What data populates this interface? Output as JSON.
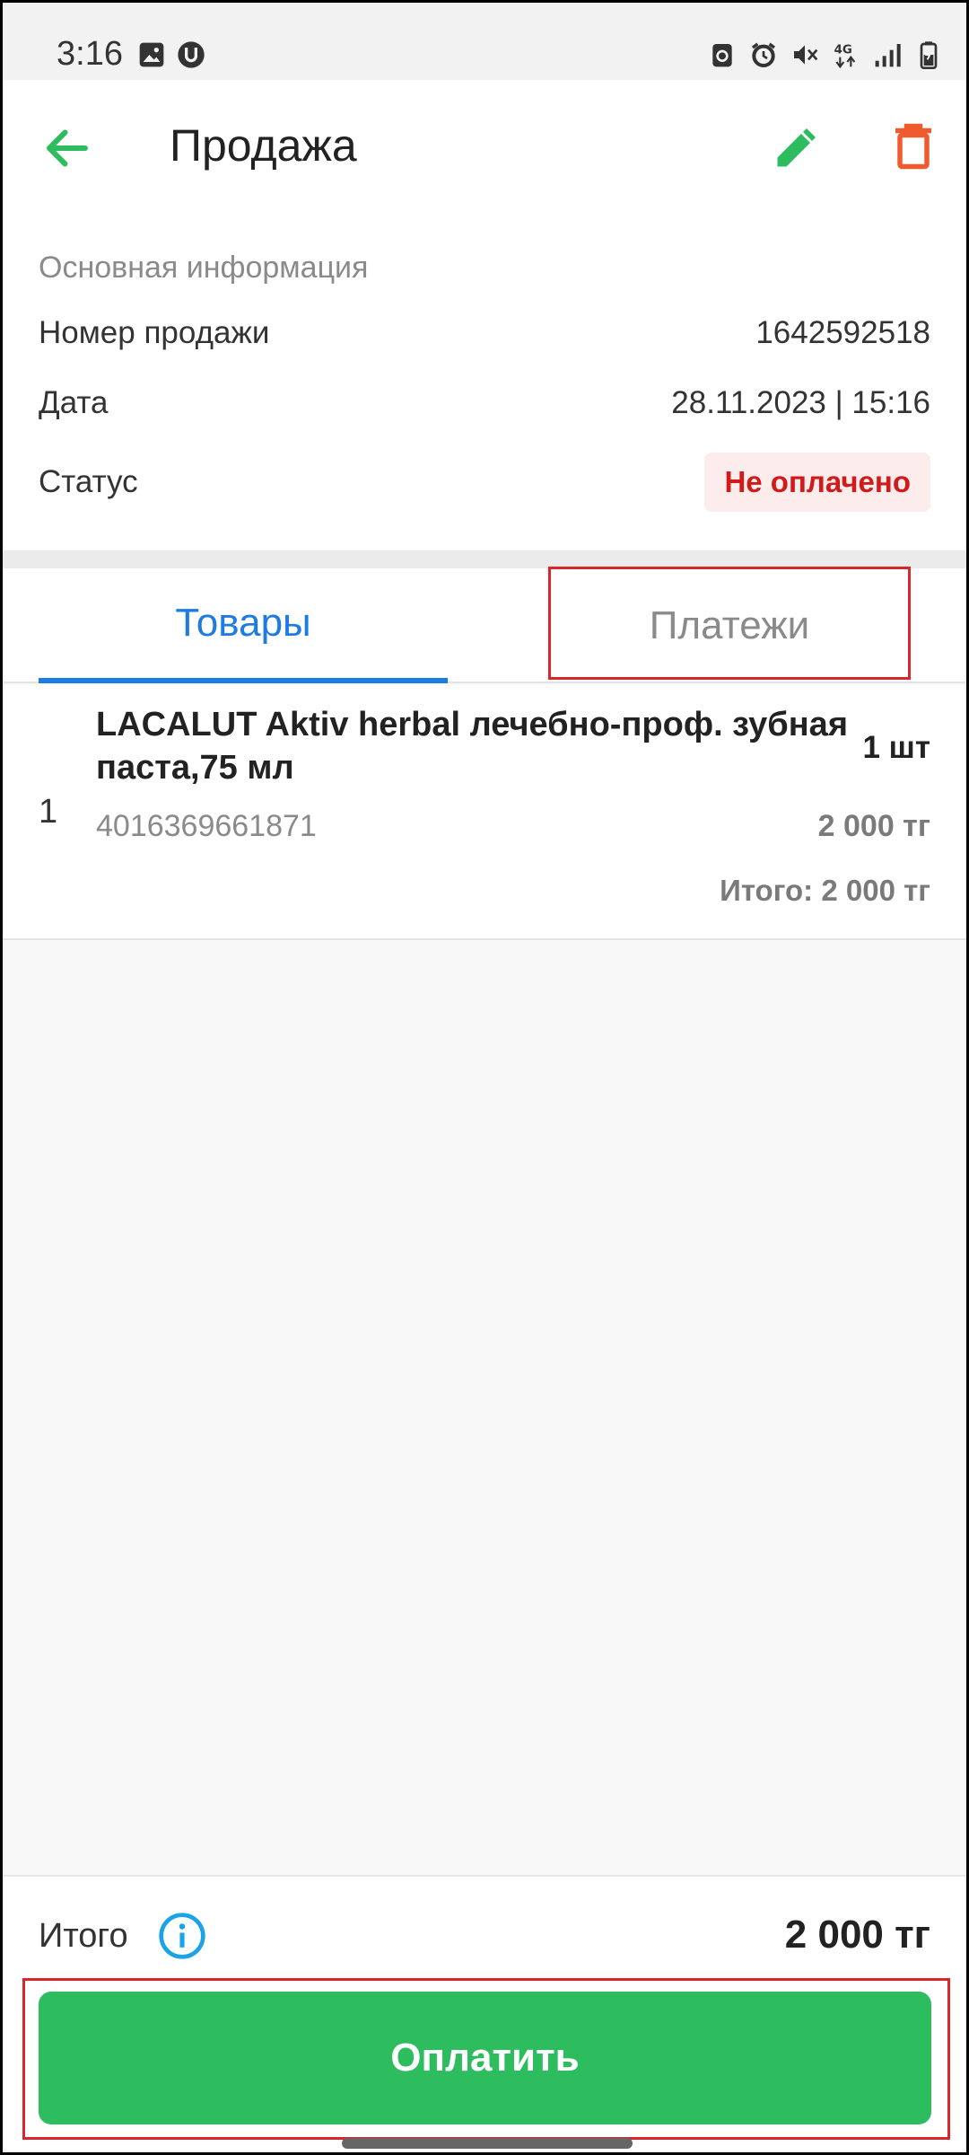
{
  "status_bar": {
    "time": "3:16",
    "left_icons": [
      "image-icon",
      "u-app-icon"
    ],
    "right_icons": [
      "recycle-icon",
      "alarm-icon",
      "mute-icon",
      "4g-icon",
      "signal-icon",
      "battery-icon"
    ]
  },
  "appbar": {
    "title": "Продажа",
    "back_icon": "arrow-left-icon",
    "edit_icon": "pencil-icon",
    "delete_icon": "trash-icon"
  },
  "info": {
    "heading": "Основная информация",
    "number_label": "Номер продажи",
    "number_value": "1642592518",
    "date_label": "Дата",
    "date_value": "28.11.2023 | 15:16",
    "status_label": "Статус",
    "status_value": "Не оплачено"
  },
  "tabs": [
    {
      "label": "Товары",
      "active": true
    },
    {
      "label": "Платежи",
      "active": false
    }
  ],
  "items": [
    {
      "index": "1",
      "name": "LACALUT Aktiv herbal лечебно-проф. зубная паста,75 мл",
      "quantity": "1 шт",
      "barcode": "4016369661871",
      "price": "2 000 тг",
      "total": "Итого: 2 000 тг"
    }
  ],
  "footer": {
    "total_label": "Итого",
    "total_value": "2 000 тг",
    "pay_button": "Оплатить"
  },
  "colors": {
    "accent_green": "#2dbd5f",
    "accent_blue": "#1e7be0",
    "danger_red": "#d11a1a",
    "highlight_red": "#d9262d"
  }
}
